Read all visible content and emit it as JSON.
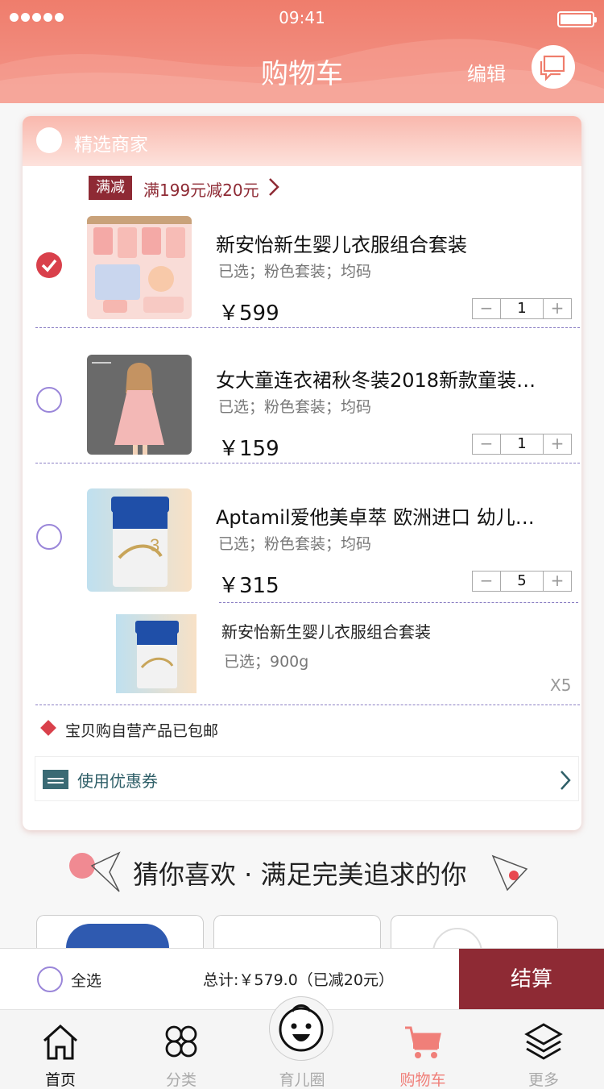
{
  "status_bar": {
    "time": "09:41"
  },
  "header": {
    "title": "购物车",
    "edit_label": "编辑",
    "message_icon": "chat-bubble-icon"
  },
  "shop": {
    "name": "精选商家"
  },
  "promo": {
    "tag": "满减",
    "text": "满199元减20元"
  },
  "items": [
    {
      "name": "新安怡新生婴儿衣服组合套装",
      "spec": "已选；粉色套装；均码",
      "price": "￥599",
      "qty": "1",
      "checked": true
    },
    {
      "name": "女大童连衣裙秋冬装2018新款童装…",
      "spec": "已选；粉色套装；均码",
      "price": "￥159",
      "qty": "1",
      "checked": false
    },
    {
      "name": "Aptamil爱他美卓萃 欧洲进口 幼儿…",
      "spec": "已选；粉色套装；均码",
      "price": "￥315",
      "qty": "5",
      "checked": false
    }
  ],
  "gift": {
    "name": "新安怡新生婴儿衣服组合套装",
    "spec": "已选；900g",
    "qty": "X5"
  },
  "shipping": {
    "text": "宝贝购自营产品已包邮"
  },
  "coupon": {
    "label": "使用优惠券"
  },
  "recommend": {
    "title": "猜你喜欢 · 满足完美追求的你"
  },
  "checkout": {
    "select_all": "全选",
    "total": "总计:￥579.0（已减20元）",
    "pay": "结算"
  },
  "tabs": [
    {
      "label": "首页",
      "icon": "home-icon"
    },
    {
      "label": "分类",
      "icon": "category-icon"
    },
    {
      "label": "育儿圈",
      "icon": "baby-face-icon"
    },
    {
      "label": "购物车",
      "icon": "cart-icon"
    },
    {
      "label": "更多",
      "icon": "layers-icon"
    }
  ],
  "colors": {
    "header": "#ef7d6c",
    "accent": "#8e2a34",
    "check": "#d9404b",
    "active_tab": "#f07f79"
  }
}
